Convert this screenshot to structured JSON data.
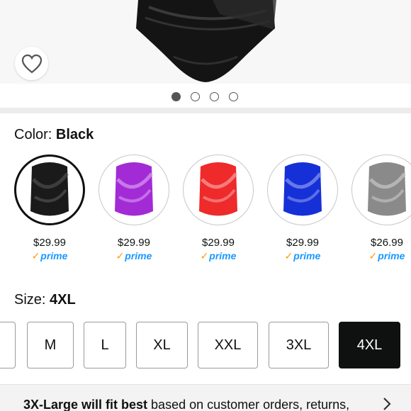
{
  "carousel": {
    "dots": [
      {
        "active": true
      },
      {
        "active": false
      },
      {
        "active": false
      },
      {
        "active": false
      }
    ]
  },
  "color": {
    "label": "Color:",
    "selected": "Black",
    "options": [
      {
        "name": "Black",
        "color": "#1a1a1a",
        "price": "$29.99",
        "prime": "prime",
        "selected": true
      },
      {
        "name": "Purple",
        "color": "#a22bd6",
        "price": "$29.99",
        "prime": "prime",
        "selected": false
      },
      {
        "name": "Red",
        "color": "#ee2a2a",
        "price": "$29.99",
        "prime": "prime",
        "selected": false
      },
      {
        "name": "Blue",
        "color": "#1630d8",
        "price": "$29.99",
        "prime": "prime",
        "selected": false
      },
      {
        "name": "Gray",
        "color": "#8a8a8a",
        "price": "$26.99",
        "prime": "prime",
        "selected": false
      }
    ]
  },
  "size": {
    "label": "Size:",
    "selected": "4XL",
    "options": [
      "",
      "M",
      "L",
      "XL",
      "XXL",
      "3XL",
      "4XL"
    ]
  },
  "fit": {
    "bold": "3X-Large will fit best",
    "rest": " based on customer orders, returns,"
  },
  "colors": {
    "prime_blue": "#1a98ff",
    "prime_check": "#ff9900",
    "selected_size_bg": "#0f1111"
  }
}
